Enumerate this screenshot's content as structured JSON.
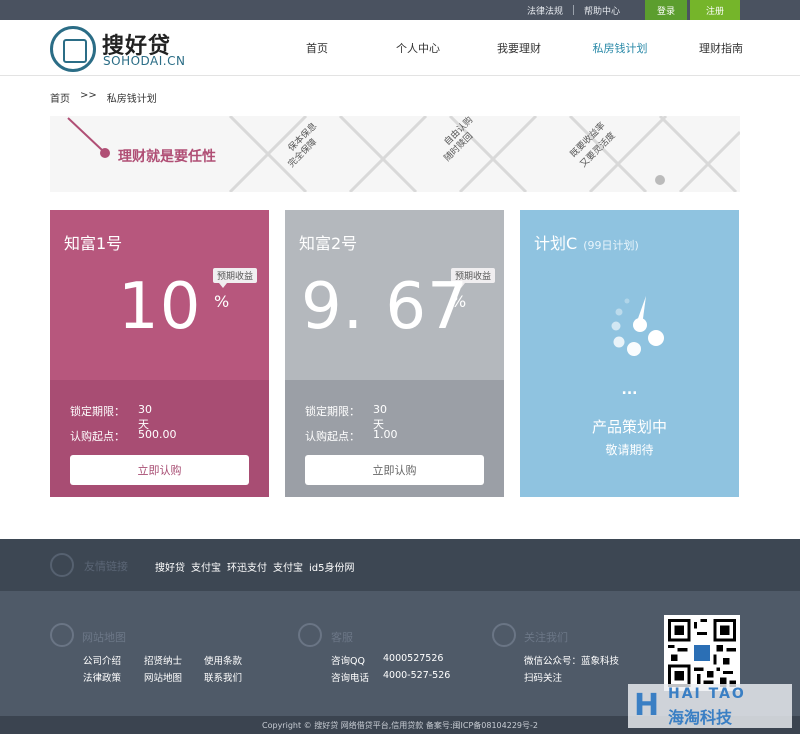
{
  "topbar": {
    "links": [
      "法律法规",
      "帮助中心"
    ],
    "login": "登录",
    "register": "注册"
  },
  "header": {
    "logo_cn": "搜好贷",
    "logo_en": "SOHODAI.CN",
    "nav": [
      {
        "label": "首页"
      },
      {
        "label": "个人中心"
      },
      {
        "label": "我要理财"
      },
      {
        "label": "私房钱计划",
        "active": true
      },
      {
        "label": "理财指南"
      }
    ]
  },
  "breadcrumb": {
    "home": "首页",
    "sep": ">>",
    "current": "私房钱计划"
  },
  "banner": {
    "slogan": "理财就是要任性",
    "texts": [
      [
        "保本保息",
        "完全保障"
      ],
      [
        "自由认购",
        "随时赎回"
      ],
      [
        "既要收益率",
        "又要灵活度"
      ]
    ]
  },
  "cards": [
    {
      "name": "知富1号",
      "rate": "10",
      "unit": "%",
      "tag": "预期收益",
      "lock_label": "锁定期限：",
      "lock_value": "30天",
      "min_label": "认购起点：",
      "min_value": "500.00",
      "button": "立即认购"
    },
    {
      "name": "知富2号",
      "rate": "9. 67",
      "unit": "%",
      "tag": "预期收益",
      "lock_label": "锁定期限：",
      "lock_value": "30天",
      "min_label": "认购起点：",
      "min_value": "1.00",
      "button": "立即认购"
    },
    {
      "name": "计划C",
      "sub": "(99日计划)",
      "ellipsis": "...",
      "status": "产品策划中",
      "note": "敬请期待"
    }
  ],
  "friend": {
    "title": "友情链接",
    "links": [
      "搜好贷",
      "支付宝",
      "环迅支付",
      "支付宝",
      "id5身份网"
    ]
  },
  "footer": {
    "sitemap": {
      "title": "网站地图",
      "links": [
        "公司介绍",
        "招贤纳士",
        "使用条款",
        "法律政策",
        "网站地图",
        "联系我们"
      ]
    },
    "service": {
      "title": "客服",
      "qq_label": "咨询QQ",
      "qq": "4000527526",
      "phone_label": "咨询电话",
      "phone": "4000-527-526"
    },
    "follow": {
      "title": "关注我们",
      "wechat": "微信公众号：蓝象科技",
      "scan": "扫码关注"
    },
    "copyright": "Copyright © 搜好贷 网络借贷平台,信用贷款 备案号:闽ICP备08104229号-2"
  },
  "watermark": {
    "en": "HAI TAO",
    "cn": "海淘科技"
  },
  "colors": {
    "card1": "#b7577d",
    "card2": "#b4b8bd",
    "card3": "#8fc3e0",
    "accent_green": "#75b52a",
    "nav_active": "#2b8aa8"
  }
}
